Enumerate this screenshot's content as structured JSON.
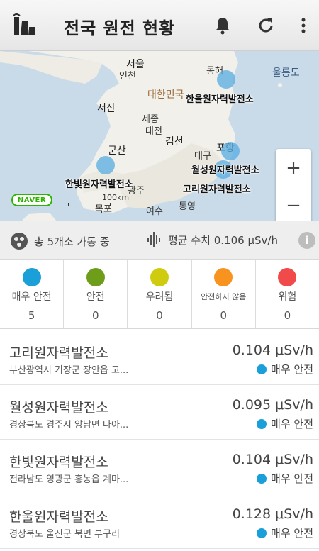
{
  "app": {
    "title": "전국 원전 현황",
    "icons": [
      "power-plant-logo-icon",
      "bell-icon",
      "refresh-icon",
      "more-vert-icon"
    ]
  },
  "map": {
    "country_label": "대한민국",
    "places": {
      "seoul": "서울",
      "incheon": "인천",
      "donghae": "동해",
      "ulleungdo": "울릉도",
      "seosan": "서산",
      "sejong": "세종",
      "daejeon": "대전",
      "gimcheon": "김천",
      "gunsan": "군산",
      "pohang": "포항",
      "daegu": "대구",
      "gwangju": "광주",
      "mokpo": "목포",
      "yeosu": "여수",
      "tongyeong": "통영"
    },
    "plant_labels": {
      "hanul": "한울원자력발전소",
      "wolseong": "월성원자력발전소",
      "hanbit": "한빛원자력발전소",
      "kori": "고리원자력발전소"
    },
    "zoom_in": "+",
    "zoom_out": "−",
    "provider": "NAVER",
    "scale": "100km"
  },
  "summary": {
    "operating": "총 5개소 가동 중",
    "average": "평균 수치 0.106 μSv/h",
    "info_label": "i"
  },
  "levels": [
    {
      "name": "매우 안전",
      "count": "5",
      "color": "#1a9fd8"
    },
    {
      "name": "안전",
      "count": "0",
      "color": "#6e9d1a"
    },
    {
      "name": "우려됨",
      "count": "0",
      "color": "#cfcc10"
    },
    {
      "name": "안전하지 않음",
      "count": "0",
      "color": "#f7931e"
    },
    {
      "name": "위험",
      "count": "0",
      "color": "#f04a4a"
    }
  ],
  "plants": [
    {
      "name": "고리원자력발전소",
      "address": "부산광역시 기장군 장안읍 고...",
      "value": "0.104 μSv/h",
      "status": "매우 안전"
    },
    {
      "name": "월성원자력발전소",
      "address": "경상북도 경주시 양남면 나아...",
      "value": "0.095 μSv/h",
      "status": "매우 안전"
    },
    {
      "name": "한빛원자력발전소",
      "address": "전라남도 영광군 홍농읍 계마...",
      "value": "0.104 μSv/h",
      "status": "매우 안전"
    },
    {
      "name": "한울원자력발전소",
      "address": "경상북도 울진군 북면 부구리",
      "value": "0.128 μSv/h",
      "status": "매우 안전"
    }
  ],
  "colors": {
    "status_very_safe": "#1a9fd8",
    "marker": "#56ace1",
    "naver_green": "#2db400"
  }
}
